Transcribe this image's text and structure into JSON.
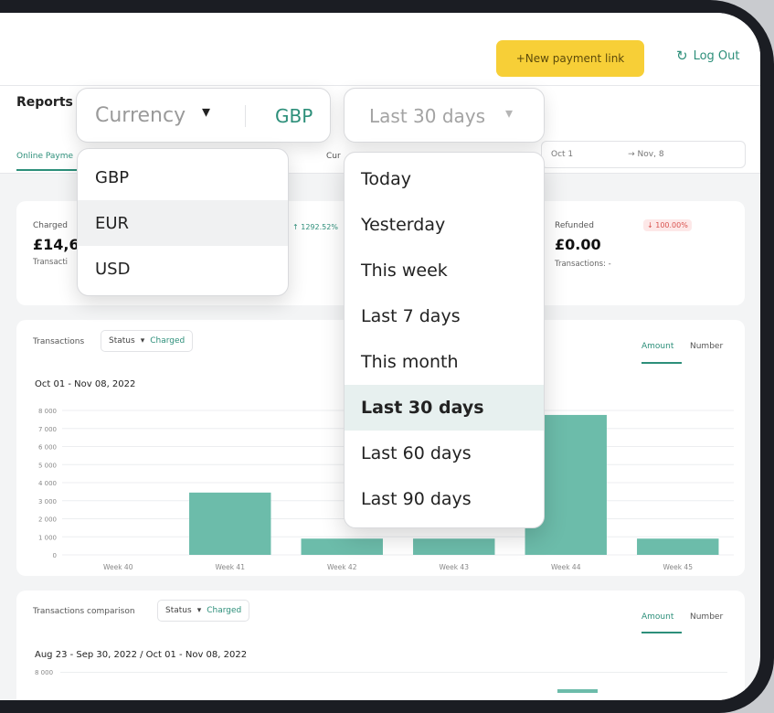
{
  "header": {
    "new_payment_label": "+New payment link",
    "logout_label": "Log Out",
    "logout_icon": "logout-icon"
  },
  "reports": {
    "title": "Reports",
    "tab_online": "Online Payme",
    "currency_label_short": "Cur",
    "date_from": "Oct 1",
    "date_to": "→ Nov, 8"
  },
  "currency_select": {
    "label": "Currency",
    "caret": "▾",
    "value": "GBP",
    "options": [
      "GBP",
      "EUR",
      "USD"
    ],
    "highlighted": "EUR"
  },
  "period_select": {
    "label": "Last 30 days",
    "caret": "▾",
    "options": [
      "Today",
      "Yesterday",
      "This week",
      "Last 7 days",
      "This month",
      "Last 30 days",
      "Last 60 days",
      "Last 90 days"
    ],
    "selected": "Last 30 days"
  },
  "stats": {
    "charged_label": "Charged",
    "charged_value": "£14,69",
    "charged_sub": "Transacti",
    "charged_badge": "↑ 1292.52%",
    "refunded_label": "Refunded",
    "refunded_value": "£0.00",
    "refunded_sub": "Transactions: -",
    "refunded_badge": "↓ 100.00%"
  },
  "transactions_chart": {
    "heading": "Transactions",
    "status_chip": "Status",
    "status_caret": "▾",
    "charged_chip": "Charged",
    "toggle_amount": "Amount",
    "toggle_number": "Number",
    "date_range": "Oct 01 - Nov 08, 2022"
  },
  "comparison_chart": {
    "heading": "Transactions comparison",
    "status_chip": "Status",
    "status_caret": "▾",
    "charged_chip": "Charged",
    "toggle_amount": "Amount",
    "toggle_number": "Number",
    "date_range": "Aug 23 - Sep 30, 2022 / Oct 01 - Nov 08, 2022",
    "first_tick": "8 000"
  },
  "chart_data": {
    "type": "bar",
    "title": "Oct 01 - Nov 08, 2022",
    "categories": [
      "Week 40",
      "Week 41",
      "Week 42",
      "Week 43",
      "Week 44",
      "Week 45"
    ],
    "values": [
      0,
      3450,
      900,
      900,
      7750,
      900
    ],
    "yticks": [
      "0",
      "1 000",
      "2 000",
      "3 000",
      "4 000",
      "5 000",
      "6 000",
      "7 000",
      "8 000"
    ],
    "ylim": [
      0,
      8000
    ],
    "grid": true,
    "color": "#6cbcaa"
  }
}
